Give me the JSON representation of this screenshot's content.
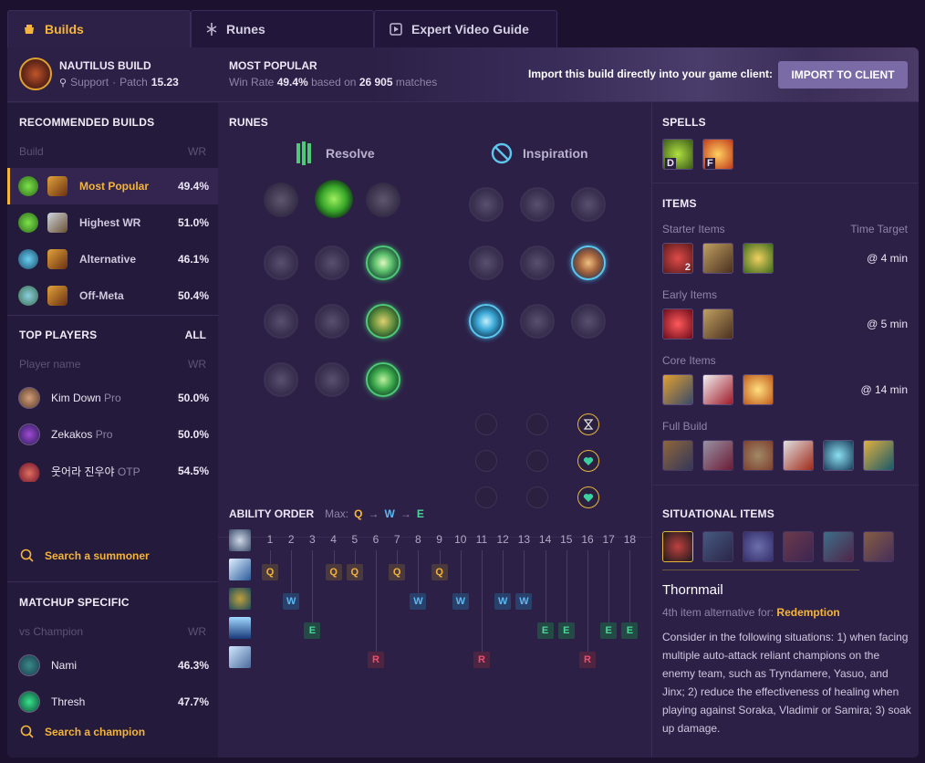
{
  "tabs": [
    {
      "label": "Builds",
      "icon": "builds-icon"
    },
    {
      "label": "Runes",
      "icon": "runes-icon"
    },
    {
      "label": "Expert Video Guide",
      "icon": "video-icon"
    }
  ],
  "header": {
    "champ_build": "NAUTILUS BUILD",
    "role": "Support",
    "patch_label": "Patch",
    "patch": "15.23",
    "mode_title": "MOST POPULAR",
    "winrate_label": "Win Rate",
    "winrate": "49.4%",
    "based_on": "based on",
    "matches_count": "26 905",
    "matches_label": "matches",
    "import_text": "Import this build directly into your game client:",
    "import_button": "IMPORT TO CLIENT"
  },
  "recommended": {
    "title": "RECOMMENDED BUILDS",
    "col_build": "Build",
    "col_wr": "WR",
    "items": [
      {
        "label": "Most Popular",
        "wr": "49.4%"
      },
      {
        "label": "Highest WR",
        "wr": "51.0%"
      },
      {
        "label": "Alternative",
        "wr": "46.1%"
      },
      {
        "label": "Off-Meta",
        "wr": "50.4%"
      }
    ]
  },
  "top_players": {
    "title": "TOP PLAYERS",
    "all": "ALL",
    "col_name": "Player name",
    "col_wr": "WR",
    "items": [
      {
        "name": "Kim Down",
        "tag": "Pro",
        "wr": "50.0%"
      },
      {
        "name": "Zekakos",
        "tag": "Pro",
        "wr": "50.0%"
      },
      {
        "name": "웃어라 진우야",
        "tag": "OTP",
        "wr": "54.5%"
      }
    ],
    "search": "Search a summoner"
  },
  "matchup": {
    "title": "MATCHUP SPECIFIC",
    "col_name": "vs Champion",
    "col_wr": "WR",
    "items": [
      {
        "name": "Nami",
        "wr": "46.3%"
      },
      {
        "name": "Thresh",
        "wr": "47.7%"
      }
    ],
    "search": "Search a champion"
  },
  "runes": {
    "title": "RUNES",
    "primary": "Resolve",
    "secondary": "Inspiration"
  },
  "spells": {
    "title": "SPELLS",
    "keys": [
      "D",
      "F"
    ]
  },
  "items": {
    "title": "ITEMS",
    "starter": "Starter Items",
    "time_target": "Time Target",
    "starter_time": "@ 4 min",
    "starter_count": "2",
    "early": "Early Items",
    "early_time": "@ 5 min",
    "core": "Core Items",
    "core_time": "@ 14 min",
    "full": "Full Build"
  },
  "ability_order": {
    "title": "ABILITY ORDER",
    "max_label": "Max:",
    "max_q": "Q",
    "max_w": "W",
    "max_e": "E",
    "arrow": "→",
    "levels": [
      "1",
      "2",
      "3",
      "4",
      "5",
      "6",
      "7",
      "8",
      "9",
      "10",
      "11",
      "12",
      "13",
      "14",
      "15",
      "16",
      "17",
      "18"
    ],
    "sequence": [
      "Q",
      "W",
      "E",
      "Q",
      "Q",
      "R",
      "Q",
      "W",
      "Q",
      "W",
      "R",
      "W",
      "W",
      "E",
      "E",
      "R",
      "E",
      "E"
    ]
  },
  "situational": {
    "title": "SITUATIONAL ITEMS",
    "item_name": "Thornmail",
    "alt_prefix": "4th item alternative for:",
    "alt_item": "Redemption",
    "description": "Consider in the following situations: 1) when facing multiple auto-attack reliant champions on the enemy team, such as Tryndamere, Yasuo, and Jinx; 2) reduce the effectiveness of healing when playing against Soraka, Vladimir or Samira; 3) soak up damage."
  }
}
